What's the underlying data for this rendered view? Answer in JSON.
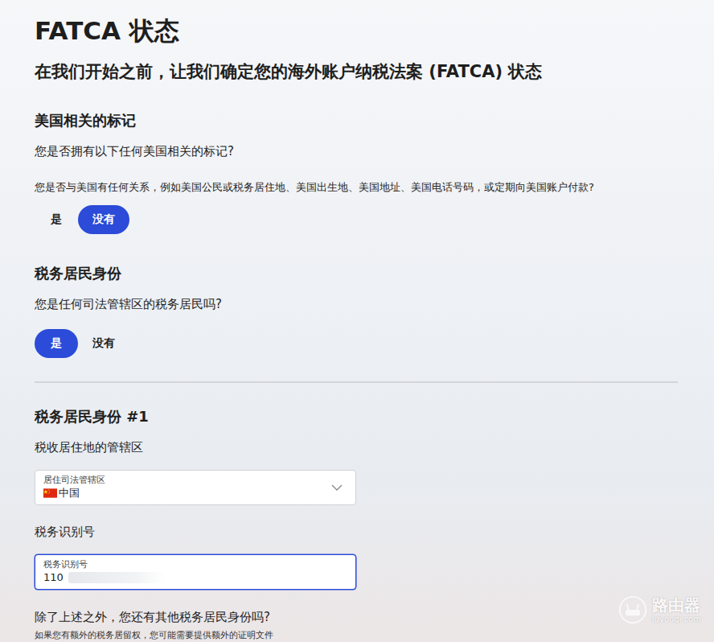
{
  "page": {
    "title": "FATCA 状态",
    "subtitle": "在我们开始之前，让我们确定您的海外账户纳税法案 (FATCA) 状态"
  },
  "sections": [
    {
      "heading": "美国相关的标记",
      "question": "您是否拥有以下任何美国相关的标记?",
      "detail": "您是否与美国有任何关系，例如美国公民或税务居住地、美国出生地、美国地址、美国电话号码，或定期向美国账户付款?",
      "options": [
        {
          "label": "是",
          "selected": false
        },
        {
          "label": "没有",
          "selected": true
        }
      ]
    },
    {
      "heading": "税务居民身份",
      "question": "您是任何司法管辖区的税务居民吗?",
      "detail": "",
      "options": [
        {
          "label": "是",
          "selected": true
        },
        {
          "label": "没有",
          "selected": false
        }
      ]
    }
  ],
  "residency": {
    "heading": "税务居民身份 #1",
    "jurisdiction": {
      "label": "税收居住地的管辖区",
      "field_label": "居住司法管辖区",
      "value": "中国",
      "focused": false
    },
    "tin": {
      "label": "税务识别号",
      "field_label": "税务识别号",
      "value": "110",
      "focused": true
    }
  },
  "additional": {
    "question": "除了上述之外，您还有其他税务居民身份吗?",
    "note": "如果您有额外的税务居留权，您可能需要提供额外的证明文件"
  },
  "watermark": {
    "text": "路由器",
    "url": "luyouqi.com"
  }
}
